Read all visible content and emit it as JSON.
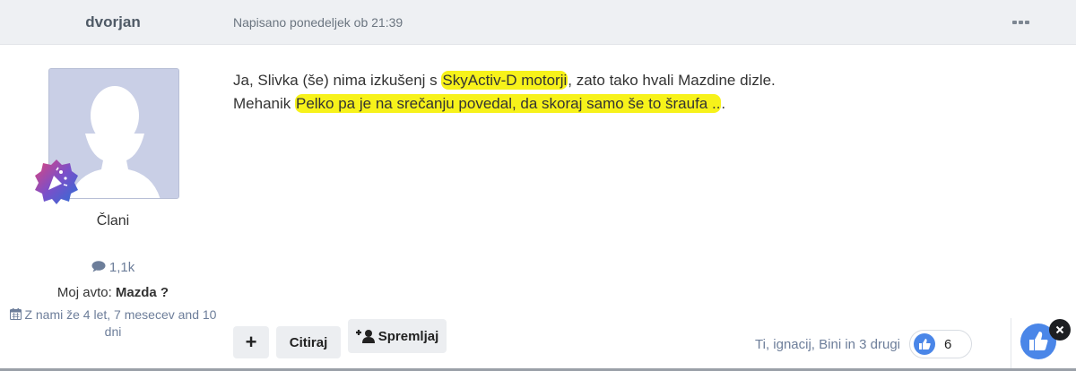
{
  "post": {
    "author": "dvorjan",
    "date": "Napisano ponedeljek ob 21:39",
    "menu_icon": "ellipsis-icon"
  },
  "sidebar": {
    "group": "Člani",
    "posts_count": "1,1k",
    "car_label": "Moj avto: ",
    "car_value": "Mazda ?",
    "joined": "Z nami že 4 let, 7 mesecev and 10 dni"
  },
  "content": {
    "line1_a": "Ja, Slivka (še) nima izkušenj s ",
    "line1_hl": "SkyActiv-D motorji",
    "line1_b": ", zato tako hvali Mazdine dizle.",
    "line2_a": "Mehanik ",
    "line2_hl": "Pelko pa je na srečanju povedal, da skoraj samo še to šraufa ..",
    "line2_b": "."
  },
  "actions": {
    "plus_label": "+",
    "quote_label": "Citiraj",
    "follow_label": "Spremljaj"
  },
  "reactions": {
    "names": "Ti, ignacij, Bini in 3 drugi",
    "count": "6"
  },
  "colors": {
    "highlight": "#f7f21a",
    "accent": "#4a86e8",
    "header_bg": "#eef0f3"
  }
}
